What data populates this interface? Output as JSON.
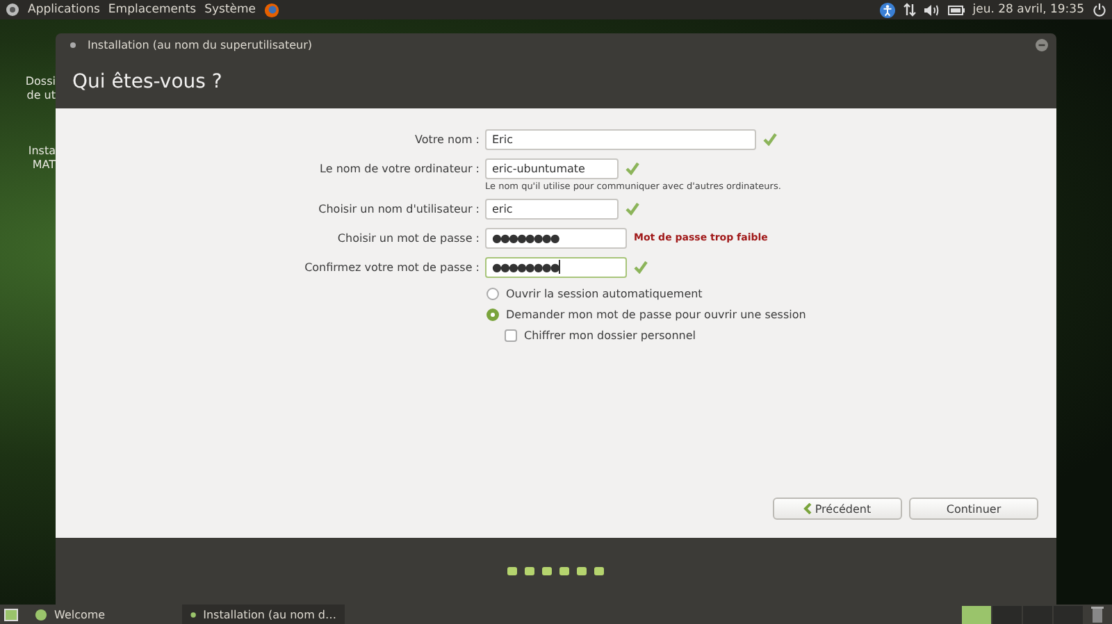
{
  "top_panel": {
    "menus": [
      "Applications",
      "Emplacements",
      "Système"
    ],
    "clock": "jeu. 28 avril, 19:35"
  },
  "desktop_icons": [
    {
      "lines": [
        "Dossi",
        "de ut"
      ]
    },
    {
      "lines": [
        "Insta",
        "MAT"
      ]
    }
  ],
  "window": {
    "title": "Installation (au nom du superutilisateur)",
    "heading": "Qui êtes-vous ?"
  },
  "form": {
    "fields": [
      {
        "label": "Votre nom :",
        "value": "Eric",
        "kind": "text",
        "valid": true,
        "focused": false
      },
      {
        "label": "Le nom de votre ordinateur :",
        "value": "eric-ubuntumate",
        "kind": "text",
        "valid": true,
        "focused": false,
        "hint": "Le nom qu'il utilise pour communiquer avec d'autres ordinateurs."
      },
      {
        "label": "Choisir un nom d'utilisateur :",
        "value": "eric",
        "kind": "text",
        "valid": true,
        "focused": false
      },
      {
        "label": "Choisir un mot de passe :",
        "value": "●●●●●●●●",
        "kind": "password",
        "valid": false,
        "focused": false,
        "warning": "Mot de passe trop faible"
      },
      {
        "label": "Confirmez votre mot de passe :",
        "value": "●●●●●●●●",
        "kind": "password",
        "valid": true,
        "focused": true
      }
    ],
    "login_options": [
      {
        "label": "Ouvrir la session automatiquement",
        "selected": false
      },
      {
        "label": "Demander mon mot de passe pour ouvrir une session",
        "selected": true
      }
    ],
    "encrypt": {
      "label": "Chiffrer mon dossier personnel",
      "checked": false
    }
  },
  "buttons": {
    "back": "Précédent",
    "next": "Continuer"
  },
  "taskbar": {
    "items": [
      {
        "label": "Welcome",
        "selected": false
      },
      {
        "label": "Installation (au nom d…",
        "selected": true
      }
    ],
    "workspaces": [
      {
        "selected": true
      },
      {
        "selected": false
      },
      {
        "selected": false
      },
      {
        "selected": false
      }
    ]
  }
}
